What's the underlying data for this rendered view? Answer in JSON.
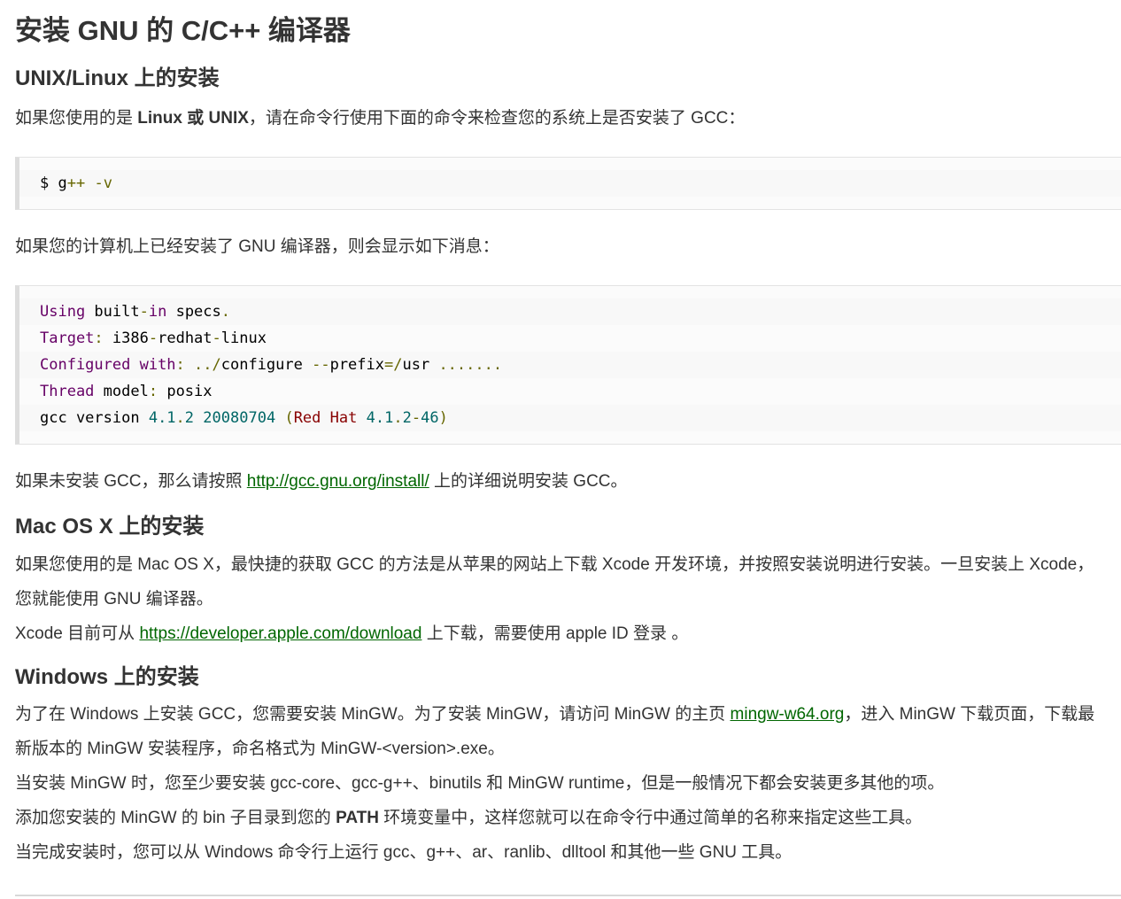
{
  "title": "安装 GNU 的 C/C++ 编译器",
  "unix": {
    "heading": "UNIX/Linux 上的安装",
    "intro_pre": "如果您使用的是 ",
    "intro_bold": "Linux 或 UNIX",
    "intro_post": "，请在命令行使用下面的命令来检查您的系统上是否安装了 GCC：",
    "cmd_prompt": "$ g",
    "cmd_plus": "++",
    "cmd_space": " ",
    "cmd_flag": "-v",
    "installed_msg": "如果您的计算机上已经安装了 GNU 编译器，则会显示如下消息：",
    "output": {
      "l1_a": "Using",
      "l1_b": " built",
      "l1_c": "-",
      "l1_d": "in",
      "l1_e": " specs",
      "l1_f": ".",
      "l2_a": "Target",
      "l2_b": ":",
      "l2_c": " i386",
      "l2_d": "-",
      "l2_e": "redhat",
      "l2_f": "-",
      "l2_g": "linux",
      "l3_a": "Configured",
      "l3_b": " with",
      "l3_c": ": ../",
      "l3_d": "configure ",
      "l3_e": "--",
      "l3_f": "prefix",
      "l3_g": "=/",
      "l3_h": "usr ",
      "l3_i": ".......",
      "l4_a": "Thread",
      "l4_b": " model",
      "l4_c": ":",
      "l4_d": " posix",
      "l5_a": "gcc version ",
      "l5_b": "4.1",
      "l5_c": ".",
      "l5_d": "2",
      "l5_e": " ",
      "l5_f": "20080704",
      "l5_g": " ",
      "l5_h": "(",
      "l5_i": "Red",
      "l5_j": " ",
      "l5_k": "Hat",
      "l5_l": " ",
      "l5_m": "4.1",
      "l5_n": ".",
      "l5_o": "2",
      "l5_p": "-",
      "l5_q": "46",
      "l5_r": ")"
    },
    "not_installed_pre": "如果未安装 GCC，那么请按照 ",
    "not_installed_link": "http://gcc.gnu.org/install/",
    "not_installed_post": " 上的详细说明安装 GCC。"
  },
  "mac": {
    "heading": "Mac OS X 上的安装",
    "line1": "如果您使用的是 Mac OS X，最快捷的获取 GCC 的方法是从苹果的网站上下载 Xcode 开发环境，并按照安装说明进行安装。一旦安装上 Xcode，",
    "line2": "您就能使用 GNU 编译器。",
    "line3_pre": "Xcode 目前可从 ",
    "line3_link": "https://developer.apple.com/download",
    "line3_post": " 上下载，需要使用 apple ID 登录 。"
  },
  "windows": {
    "heading": "Windows 上的安装",
    "line1_pre": "为了在 Windows 上安装 GCC，您需要安装 MinGW。为了安装 MinGW，请访问 MinGW 的主页 ",
    "line1_link": "mingw-w64.org",
    "line1_post": "，进入 MinGW 下载页面，下载最",
    "line2": "新版本的 MinGW 安装程序，命名格式为 MinGW-<version>.exe。",
    "line3": "当安装 MinGW 时，您至少要安装 gcc-core、gcc-g++、binutils 和 MinGW runtime，但是一般情况下都会安装更多其他的项。",
    "line4_pre": "添加您安装的 MinGW 的 bin 子目录到您的 ",
    "line4_bold": "PATH",
    "line4_post": " 环境变量中，这样您就可以在命令行中通过简单的名称来指定这些工具。",
    "line5": "当完成安装时，您可以从 Windows 命令行上运行 gcc、g++、ar、ranlib、dlltool 和其他一些 GNU 工具。"
  },
  "colors": {
    "link": "#006600",
    "text": "#333333",
    "code_keyword": "#660066",
    "code_punct": "#666600",
    "code_number": "#006666",
    "code_string": "#880000"
  }
}
